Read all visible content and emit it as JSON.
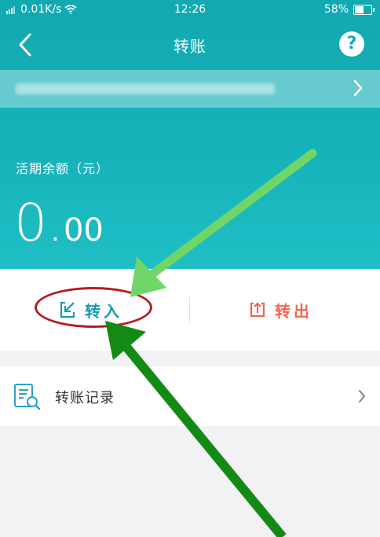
{
  "status_bar": {
    "network_speed": "0.01K/s",
    "time": "12:26",
    "battery": "58%",
    "battery_level": 0.58
  },
  "nav": {
    "title": "转账",
    "help_label": "?"
  },
  "balance": {
    "label": "活期余额（元）",
    "integer": "0.",
    "decimal": "00"
  },
  "actions": {
    "transfer_in_label": "转入",
    "transfer_out_label": "转出"
  },
  "records": {
    "label": "转账记录"
  },
  "colors": {
    "brand": "#16b2ba",
    "transfer_in": "#159bb0",
    "transfer_out": "#f0664f",
    "annotation_ellipse": "#b51c22",
    "annotation_arrow_light": "#6fd667",
    "annotation_arrow_dark": "#138a14"
  }
}
